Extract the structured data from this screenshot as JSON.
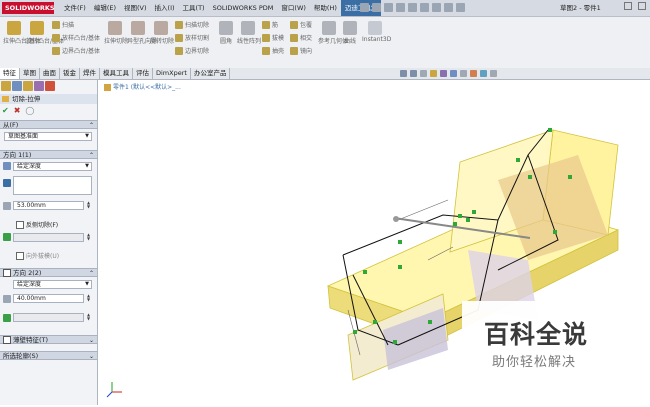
{
  "app": {
    "logo_text": "SOLIDWORKS",
    "document_title": "草图2 - 零件1"
  },
  "menu": [
    "文件(F)",
    "编辑(E)",
    "视图(V)",
    "插入(I)",
    "工具(T)",
    "SOLIDWORKS PDM",
    "窗口(W)",
    "帮助(H)",
    "迈迪工具集"
  ],
  "ribbon": {
    "big": [
      {
        "label": "拉伸凸台/基体",
        "color": "#c9a640"
      },
      {
        "label": "旋转凸台/基体",
        "color": "#c9a640"
      },
      {
        "label": "拉伸切除",
        "color": "#b9a9a0"
      },
      {
        "label": "异型孔向导",
        "color": "#b9a9a0"
      },
      {
        "label": "旋转切除",
        "color": "#b9a9a0"
      },
      {
        "label": "圆角",
        "color": "#b0b4ba"
      },
      {
        "label": "线性阵列",
        "color": "#b0b4ba"
      },
      {
        "label": "参考几何体",
        "color": "#b0b4ba"
      },
      {
        "label": "曲线",
        "color": "#b0b4ba"
      },
      {
        "label": "Instant3D",
        "color": "#c5cad2"
      }
    ],
    "small": [
      "扫描",
      "放样凸台/基体",
      "边界凸台/基体",
      "扫描切除",
      "放样切割",
      "边界切除",
      "筋",
      "拔模",
      "抽壳",
      "包覆",
      "相交",
      "镜向"
    ]
  },
  "tabs": [
    "特征",
    "草图",
    "曲面",
    "钣金",
    "焊件",
    "模具工具",
    "评估",
    "DimXpert",
    "办公室产品"
  ],
  "active_tab": "特征",
  "feature_manager": {
    "title": "切除-拉伸",
    "from": {
      "header": "从(F)",
      "value": "草图基准面"
    },
    "direction1": {
      "header": "方向 1(1)",
      "end_condition": "给定深度",
      "depth": "53.00mm",
      "flip_side": "反侧切除(F)",
      "draft_outward": "向外拔模(U)"
    },
    "direction2": {
      "header": "方向 2(2)",
      "end_condition": "给定深度",
      "depth": "40.00mm"
    },
    "thin_feature": "薄壁特征(T)",
    "selected_contours": "所选轮廓(S)"
  },
  "viewport": {
    "tree_label": "零件1 (默认<<默认>_..."
  },
  "watermark": {
    "title": "百科全说",
    "subtitle": "助你轻松解决"
  }
}
